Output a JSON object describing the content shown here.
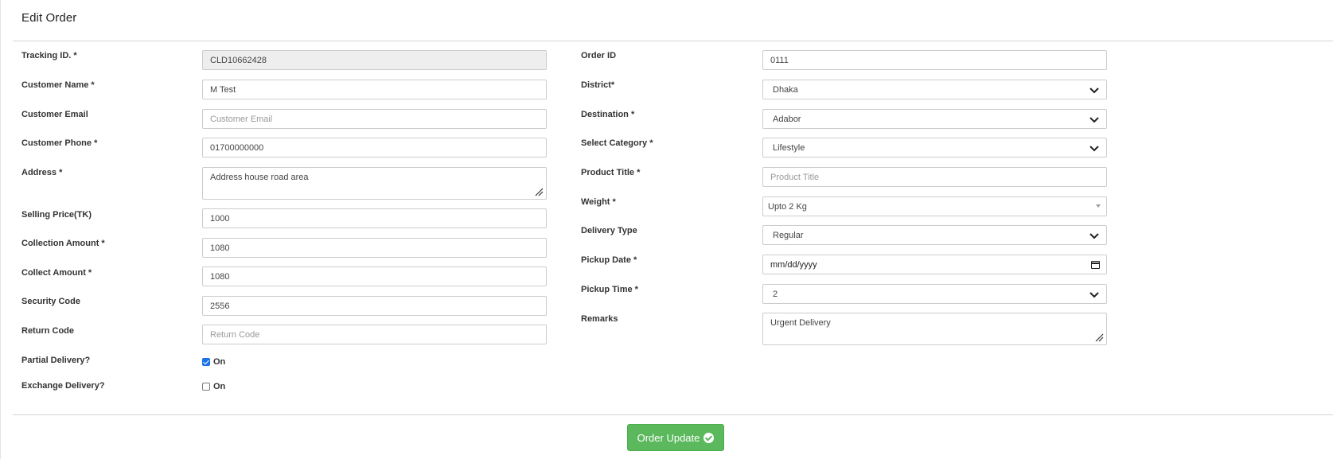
{
  "page": {
    "title": "Edit Order"
  },
  "left": {
    "tracking_id": {
      "label": "Tracking ID. *",
      "value": "CLD10662428"
    },
    "customer_name": {
      "label": "Customer Name *",
      "value": "M Test"
    },
    "customer_email": {
      "label": "Customer Email",
      "value": "",
      "placeholder": "Customer Email"
    },
    "customer_phone": {
      "label": "Customer Phone *",
      "value": "01700000000"
    },
    "address": {
      "label": "Address *",
      "value": "Address house road area"
    },
    "selling_price": {
      "label": "Selling Price(TK)",
      "value": "1000"
    },
    "collection_amount": {
      "label": "Collection Amount *",
      "value": "1080"
    },
    "collect_amount": {
      "label": "Collect Amount *",
      "value": "1080"
    },
    "security_code": {
      "label": "Security Code",
      "value": "2556"
    },
    "return_code": {
      "label": "Return Code",
      "value": "",
      "placeholder": "Return Code"
    },
    "partial_delivery": {
      "label": "Partial Delivery?",
      "option": "On",
      "checked": true
    },
    "exchange_delivery": {
      "label": "Exchange Delivery?",
      "option": "On",
      "checked": false
    }
  },
  "right": {
    "order_id": {
      "label": "Order ID",
      "value": "0111"
    },
    "district": {
      "label": "District*",
      "selected": "Dhaka"
    },
    "destination": {
      "label": "Destination *",
      "selected": "Adabor"
    },
    "category": {
      "label": "Select Category *",
      "selected": "Lifestyle"
    },
    "product_title": {
      "label": "Product Title *",
      "value": "",
      "placeholder": "Product Title"
    },
    "weight": {
      "label": "Weight *",
      "selected": "Upto 2 Kg"
    },
    "delivery_type": {
      "label": "Delivery Type",
      "selected": "Regular"
    },
    "pickup_date": {
      "label": "Pickup Date *",
      "value": "mm/dd/yyyy"
    },
    "pickup_time": {
      "label": "Pickup Time *",
      "selected": "2"
    },
    "remarks": {
      "label": "Remarks",
      "value": "Urgent Delivery"
    }
  },
  "submit": {
    "label": "Order Update"
  },
  "colors": {
    "primary_button": "#5cb85c",
    "checkbox_checked": "#1a73e8"
  }
}
